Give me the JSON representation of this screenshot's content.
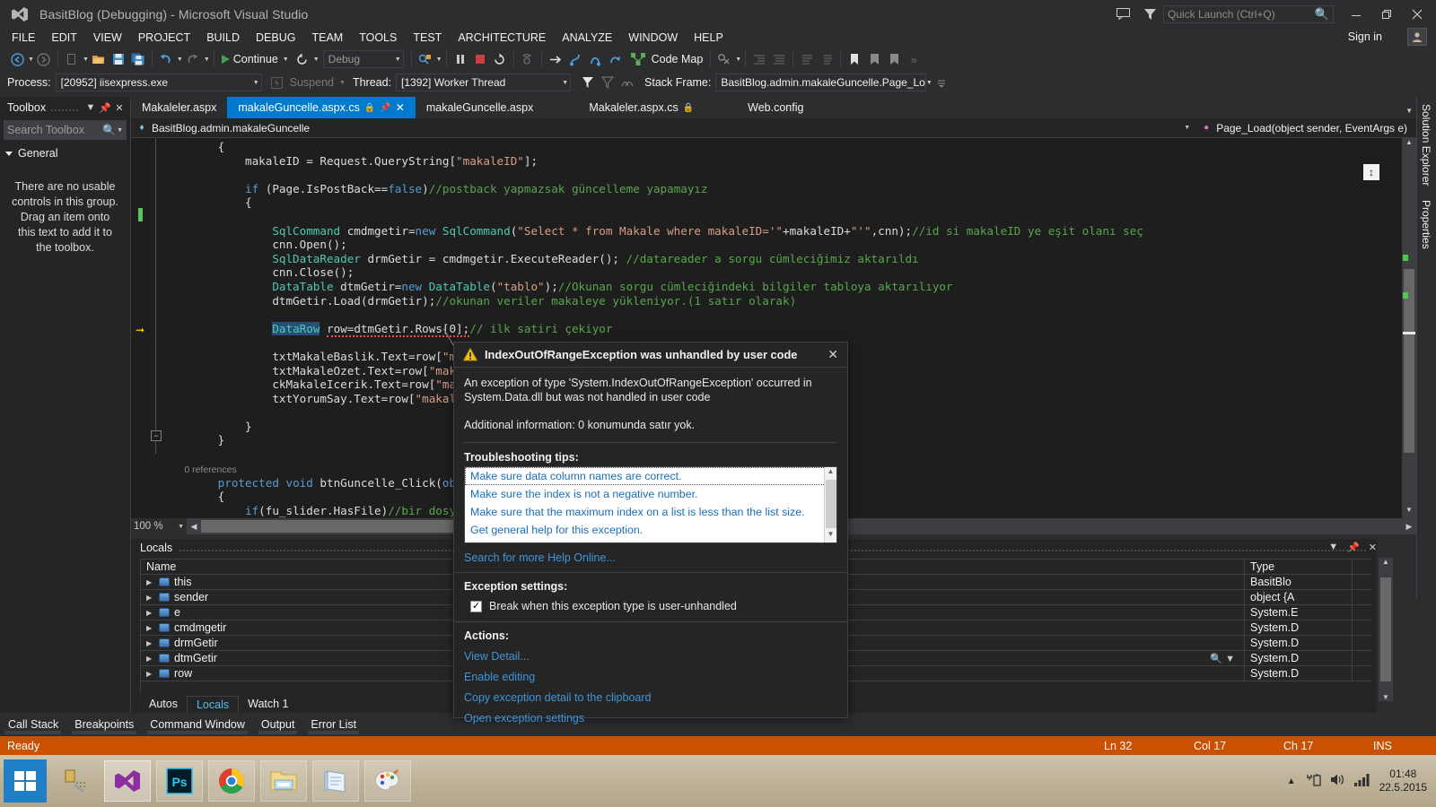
{
  "titlebar": {
    "title": "BasitBlog (Debugging) - Microsoft Visual Studio",
    "logo_icon": "visual-studio-logo",
    "feedback_icon": "feedback-icon",
    "filter_icon": "filter-icon",
    "quick_launch_placeholder": "Quick Launch (Ctrl+Q)",
    "search_icon": "search-icon",
    "minimize": "—",
    "maximize": "❐",
    "close": "✕",
    "sign_in": "Sign in",
    "account_icon": "account-icon"
  },
  "menubar": {
    "items": [
      "FILE",
      "EDIT",
      "VIEW",
      "PROJECT",
      "BUILD",
      "DEBUG",
      "TEAM",
      "TOOLS",
      "TEST",
      "ARCHITECTURE",
      "ANALYZE",
      "WINDOW",
      "HELP"
    ]
  },
  "toolbar": {
    "navigate_back_icon": "navigate-back-icon",
    "navigate_forward_icon": "navigate-forward-icon",
    "new_item_icon": "new-item-icon",
    "open_file_icon": "open-file-icon",
    "save_icon": "save-icon",
    "save_all_icon": "save-all-icon",
    "undo_icon": "undo-icon",
    "redo_icon": "redo-icon",
    "continue_label": "Continue",
    "restart_icon": "restart-icon",
    "config_value": "Debug",
    "attach_icon": "attach-to-process-icon",
    "pause_icon": "pause-icon",
    "stop_icon": "stop-icon",
    "restart_debug_icon": "restart-debug-icon",
    "show_next_statement_icon": "show-next-statement-icon",
    "step_into_icon": "step-into-icon",
    "step_over_icon": "step-over-icon",
    "step_out_icon": "step-out-icon",
    "code_map_label": "Code Map",
    "code_map_icon": "code-map-icon",
    "breakpoint_icon": "breakpoint-icon",
    "indent_icon": "indent-icon",
    "outdent_icon": "outdent-icon",
    "comment_icon": "comment-icon",
    "uncomment_icon": "uncomment-icon",
    "bookmark_icon": "bookmark-icon",
    "prev_bookmark_icon": "previous-bookmark-icon",
    "next_bookmark_icon": "next-bookmark-icon"
  },
  "debugbar": {
    "process_label": "Process:",
    "process_value": "[20952] iisexpress.exe",
    "suspend_label": "Suspend",
    "thread_label": "Thread:",
    "thread_value": "[1392] Worker Thread",
    "stackframe_label": "Stack Frame:",
    "stackframe_value": "BasitBlog.admin.makaleGuncelle.Page_Lo",
    "lifecycle_icon": "lifecycle-events-icon",
    "flag_icon": "flag-icon",
    "flag_filter_icon": "flag-filter-icon",
    "threads_icon": "threads-icon"
  },
  "toolbox": {
    "title": "Toolbox",
    "dropdown_icon": "chevron-down-icon",
    "pin_icon": "pin-icon",
    "close_icon": "close-icon",
    "search_placeholder": "Search Toolbox",
    "search_icon": "search-icon",
    "group_label": "General",
    "empty_message": "There are no usable controls in this group. Drag an item onto this text to add it to the toolbox."
  },
  "right_dock": {
    "tabs": [
      "Solution Explorer",
      "Properties"
    ]
  },
  "editor": {
    "tabs": [
      {
        "label": "Makaleler.aspx",
        "active": false,
        "lock": false
      },
      {
        "label": "makaleGuncelle.aspx.cs",
        "active": true,
        "lock": true
      },
      {
        "label": "makaleGuncelle.aspx",
        "active": false,
        "lock": false
      },
      {
        "label": "Makaleler.aspx.cs",
        "active": false,
        "lock": true
      },
      {
        "label": "Web.config",
        "active": false,
        "lock": false
      }
    ],
    "pin_icon": "pin-icon",
    "close_icon": "close-icon",
    "lock_icon": "lock-icon",
    "nav_left": "BasitBlog.admin.makaleGuncelle",
    "nav_right": "Page_Load(object sender, EventArgs e)",
    "nav_left_icon": "namespace-icon",
    "nav_right_icon": "method-icon",
    "zoom_level": "100 %",
    "split_icon": "split-view-icon"
  },
  "code": {
    "lines": [
      "        {",
      "            makaleID = Request.QueryString[\"makaleID\"];",
      "",
      "            if (Page.IsPostBack==false)//postback yapmazsak güncelleme yapamayız",
      "            {",
      "",
      "                SqlCommand cmdmgetir=new SqlCommand(\"Select * from Makale where makaleID='\"+makaleID+\"'\",cnn);//id si makaleID ye eşit olanı seç",
      "                cnn.Open();",
      "                SqlDataReader drmGetir = cmdmgetir.ExecuteReader(); //datareader a sorgu cümleciğimiz aktarıldı",
      "                cnn.Close();",
      "                DataTable dtmGetir=new DataTable(\"tablo\");//Okunan sorgu cümleciğindeki bilgiler tabloya aktarılıyor",
      "                dtmGetir.Load(drmGetir);//okunan veriler makaleye yükleniyor.(1 satır olarak)",
      "",
      "                DataRow row=dtmGetir.Rows[0];// ilk satiri çekiyor",
      "",
      "                txtMakaleBaslik.Text=row[\"maka",
      "                txtMakaleOzet.Text=row[\"makale",
      "                ckMakaleIcerik.Text=row[\"makale",
      "                txtYorumSay.Text=row[\"makaleYor",
      "",
      "            }",
      "        }",
      "",
      "        0 references",
      "        protected void btnGuncelle_Click(object",
      "        {",
      "            if(fu_slider.HasFile)//bir dosya va"
    ]
  },
  "locals": {
    "title": "Locals",
    "dropdown_icon": "chevron-down-icon",
    "pin_icon": "pin-icon",
    "close_icon": "close-icon",
    "columns": [
      "Name",
      "Type"
    ],
    "rows": [
      {
        "name": "this",
        "type": "BasitBlo"
      },
      {
        "name": "sender",
        "type": "object {A"
      },
      {
        "name": "e",
        "type": "System.E"
      },
      {
        "name": "cmdmgetir",
        "type": "System.D"
      },
      {
        "name": "drmGetir",
        "type": "System.D"
      },
      {
        "name": "dtmGetir",
        "type": "System.D"
      },
      {
        "name": "row",
        "type": "System.D"
      }
    ],
    "search_icon": "search-icon",
    "watch_tabs": [
      {
        "label": "Autos",
        "active": false
      },
      {
        "label": "Locals",
        "active": true
      },
      {
        "label": "Watch 1",
        "active": false
      }
    ]
  },
  "bottom_tabs": [
    "Call Stack",
    "Breakpoints",
    "Command Window",
    "Output",
    "Error List"
  ],
  "statusbar": {
    "ready": "Ready",
    "line": "Ln 32",
    "col": "Col 17",
    "ch": "Ch 17",
    "ins": "INS"
  },
  "exception_dialog": {
    "warning_icon": "warning-icon",
    "title": "IndexOutOfRangeException was unhandled by user code",
    "close_icon": "close-icon",
    "message": "An exception of type 'System.IndexOutOfRangeException' occurred in System.Data.dll but was not handled in user code",
    "additional": "Additional information: 0 konumunda satır yok.",
    "tips_label": "Troubleshooting tips:",
    "tips": [
      "Make sure data column names are correct.",
      "Make sure the index is not a negative number.",
      "Make sure that the maximum index on a list is less than the list size.",
      "Get general help for this exception."
    ],
    "search_online": "Search for more Help Online...",
    "settings_label": "Exception settings:",
    "checkbox_checked": "✓",
    "checkbox_label": "Break when this exception type is user-unhandled",
    "actions_label": "Actions:",
    "actions": [
      "View Detail...",
      "Enable editing",
      "Copy exception detail to the clipboard",
      "Open exception settings"
    ]
  },
  "taskbar": {
    "start_icon": "windows-start-icon",
    "items": [
      {
        "icon": "task-view-icon",
        "pinned": false
      },
      {
        "icon": "visual-studio-icon",
        "pinned": true
      },
      {
        "icon": "photoshop-icon",
        "pinned": false
      },
      {
        "icon": "chrome-icon",
        "pinned": false
      },
      {
        "icon": "file-explorer-icon",
        "pinned": false
      },
      {
        "icon": "notepad-icon",
        "pinned": false
      },
      {
        "icon": "paint-icon",
        "pinned": false
      }
    ],
    "tray": {
      "show_hidden_icon": "show-hidden-icons-icon",
      "battery_icon": "battery-icon",
      "volume_icon": "volume-icon",
      "network_icon": "network-icon",
      "time": "01:48",
      "date": "22.5.2015"
    }
  },
  "colors": {
    "accent": "#007acc",
    "status_bar": "#ca5100",
    "chrome": "#2d2d30",
    "editor_bg": "#1e1e1e",
    "link": "#3d96d8"
  }
}
